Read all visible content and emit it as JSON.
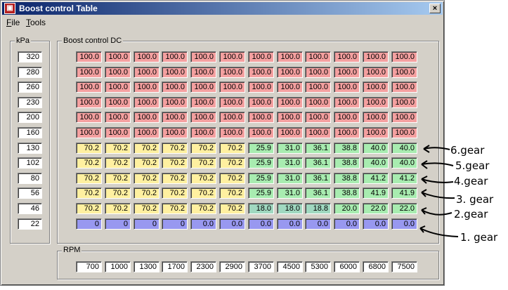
{
  "window": {
    "title": "Boost control Table",
    "close_glyph": "×",
    "icon_glyph": "▣"
  },
  "menu": [
    {
      "label_ul": "F",
      "label_rest": "ile"
    },
    {
      "label_ul": "T",
      "label_rest": "ools"
    }
  ],
  "kpa_group": {
    "label": "kPa",
    "values": [
      "320",
      "280",
      "260",
      "230",
      "200",
      "160",
      "130",
      "102",
      "80",
      "56",
      "46",
      "22"
    ]
  },
  "dc_group": {
    "label": "Boost control DC",
    "rows": [
      [
        "100.0",
        "100.0",
        "100.0",
        "100.0",
        "100.0",
        "100.0",
        "100.0",
        "100.0",
        "100.0",
        "100.0",
        "100.0",
        "100.0"
      ],
      [
        "100.0",
        "100.0",
        "100.0",
        "100.0",
        "100.0",
        "100.0",
        "100.0",
        "100.0",
        "100.0",
        "100.0",
        "100.0",
        "100.0"
      ],
      [
        "100.0",
        "100.0",
        "100.0",
        "100.0",
        "100.0",
        "100.0",
        "100.0",
        "100.0",
        "100.0",
        "100.0",
        "100.0",
        "100.0"
      ],
      [
        "100.0",
        "100.0",
        "100.0",
        "100.0",
        "100.0",
        "100.0",
        "100.0",
        "100.0",
        "100.0",
        "100.0",
        "100.0",
        "100.0"
      ],
      [
        "100.0",
        "100.0",
        "100.0",
        "100.0",
        "100.0",
        "100.0",
        "100.0",
        "100.0",
        "100.0",
        "100.0",
        "100.0",
        "100.0"
      ],
      [
        "100.0",
        "100.0",
        "100.0",
        "100.0",
        "100.0",
        "100.0",
        "100.0",
        "100.0",
        "100.0",
        "100.0",
        "100.0",
        "100.0"
      ],
      [
        "70.2",
        "70.2",
        "70.2",
        "70.2",
        "70.2",
        "70.2",
        "25.9",
        "31.0",
        "36.1",
        "38.8",
        "40.0",
        "40.0"
      ],
      [
        "70.2",
        "70.2",
        "70.2",
        "70.2",
        "70.2",
        "70.2",
        "25.9",
        "31.0",
        "36.1",
        "38.8",
        "40.0",
        "40.0"
      ],
      [
        "70.2",
        "70.2",
        "70.2",
        "70.2",
        "70.2",
        "70.2",
        "25.9",
        "31.0",
        "36.1",
        "38.8",
        "41.2",
        "41.2"
      ],
      [
        "70.2",
        "70.2",
        "70.2",
        "70.2",
        "70.2",
        "70.2",
        "25.9",
        "31.0",
        "36.1",
        "38.8",
        "41.9",
        "41.9"
      ],
      [
        "70.2",
        "70.2",
        "70.2",
        "70.2",
        "70.2",
        "70.2",
        "18.0",
        "18.0",
        "18.8",
        "20.0",
        "22.0",
        "22.0"
      ],
      [
        "0",
        "0",
        "0",
        "0",
        "0.0",
        "0.0",
        "0.0",
        "0.0",
        "0.0",
        "0.0",
        "0.0",
        "0.0"
      ]
    ],
    "colors": {
      "red": "#f4a0a0",
      "yellow": "#fff0a0",
      "green": "#a8ecb0",
      "teal": "#a0d8c0",
      "blue": "#9898f0"
    }
  },
  "rpm_group": {
    "label": "RPM",
    "values": [
      "700",
      "1000",
      "1300",
      "1700",
      "2300",
      "2900",
      "3700",
      "4500",
      "5300",
      "6000",
      "6800",
      "7500"
    ]
  },
  "annotations": [
    "6.gear",
    "5.gear",
    "4.gear",
    "3. gear",
    "2.gear",
    "1. gear"
  ]
}
